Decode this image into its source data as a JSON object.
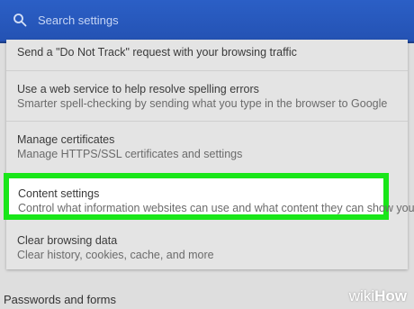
{
  "search": {
    "placeholder": "Search settings"
  },
  "settings": {
    "dnt": {
      "title": "Send a \"Do Not Track\" request with your browsing traffic"
    },
    "spelling": {
      "title": "Use a web service to help resolve spelling errors",
      "subtitle": "Smarter spell-checking by sending what you type in the browser to Google"
    },
    "certificates": {
      "title": "Manage certificates",
      "subtitle": "Manage HTTPS/SSL certificates and settings"
    },
    "content": {
      "title": "Content settings",
      "subtitle": "Control what information websites can use and what content they can show you"
    },
    "clear": {
      "title": "Clear browsing data",
      "subtitle": "Clear history, cookies, cache, and more"
    }
  },
  "section": {
    "passwords_title": "Passwords and forms"
  },
  "watermark": {
    "wiki": "wiki",
    "how": "How"
  },
  "colors": {
    "topbar": "#2b5fc6",
    "highlight_border": "#19e619"
  }
}
